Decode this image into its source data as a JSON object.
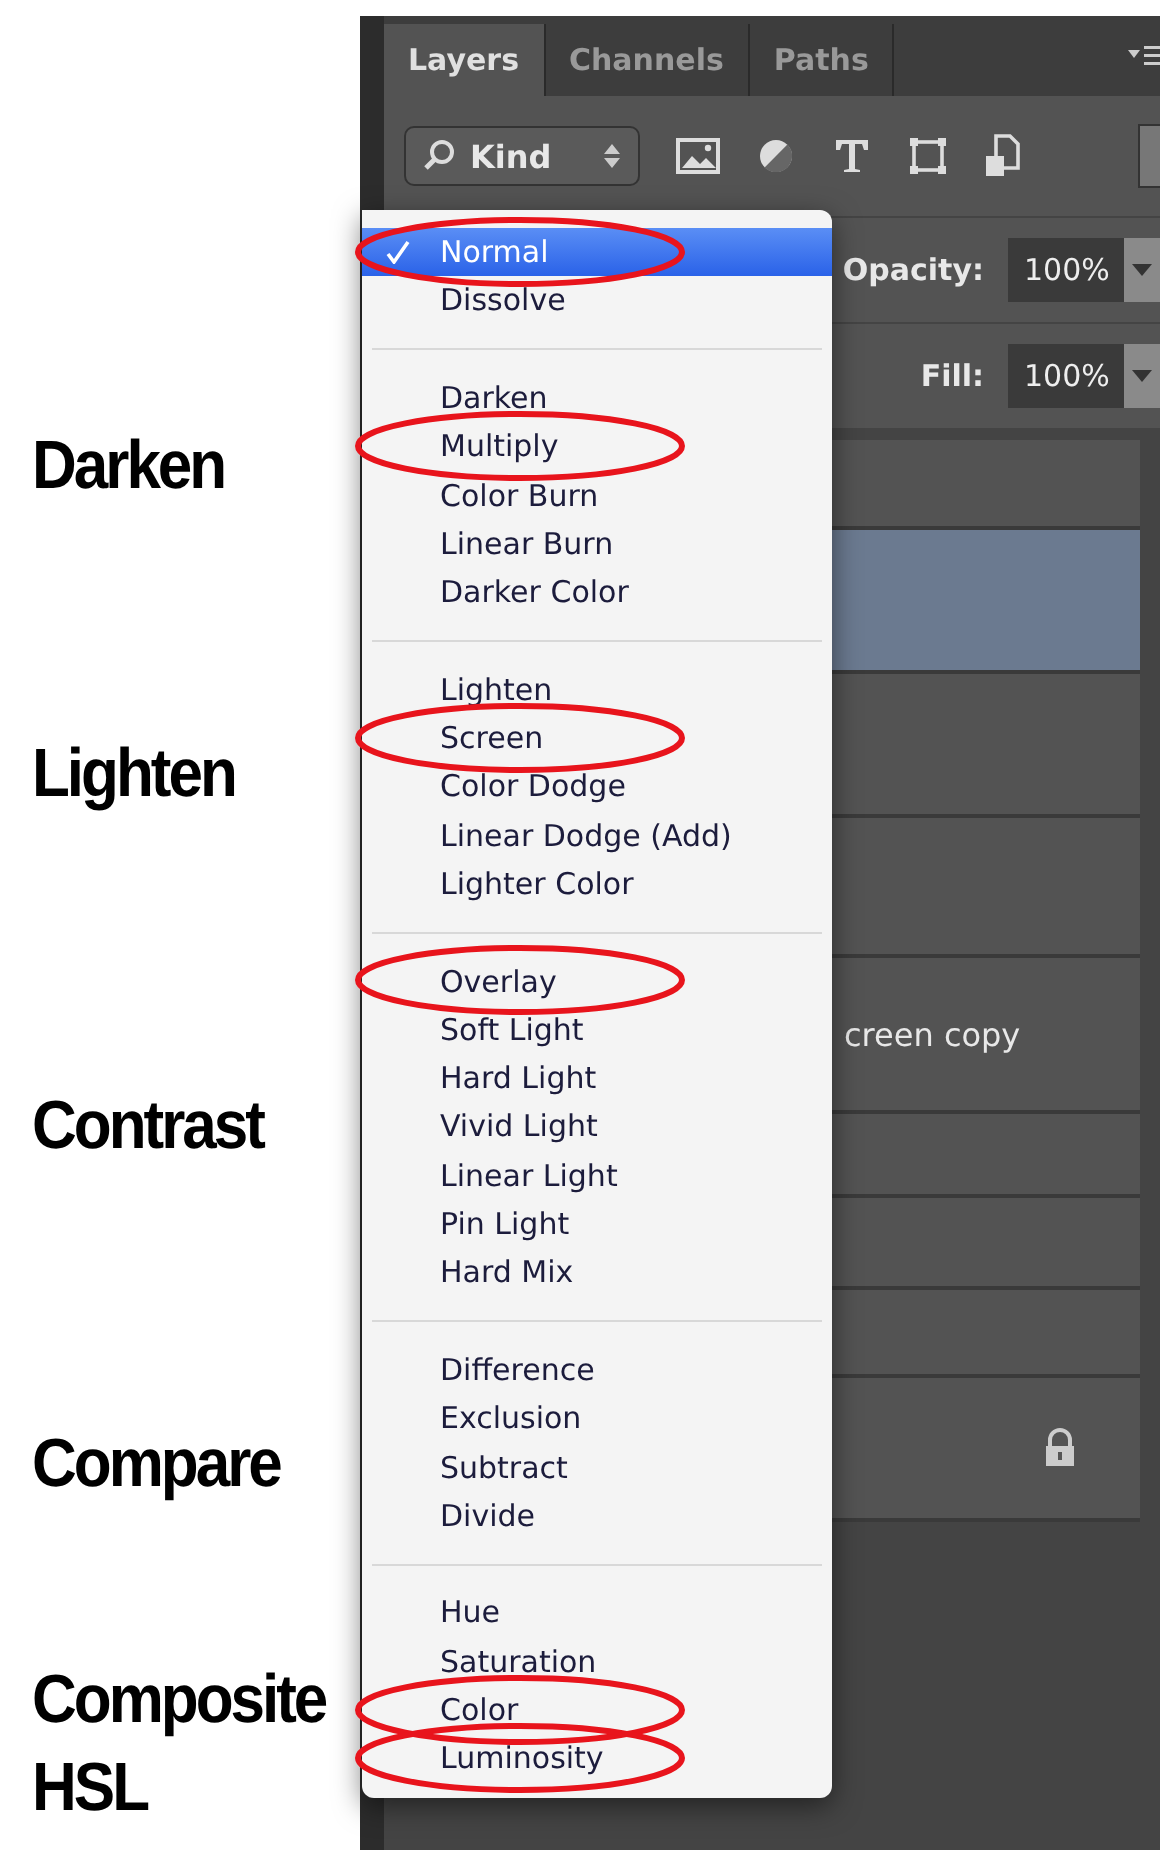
{
  "annotations": [
    {
      "label": "Darken"
    },
    {
      "label": "Lighten"
    },
    {
      "label": "Contrast"
    },
    {
      "label": "Compare"
    },
    {
      "label": "Composite HSL"
    }
  ],
  "tabs": [
    {
      "label": "Layers",
      "selected": true
    },
    {
      "label": "Channels",
      "selected": false
    },
    {
      "label": "Paths",
      "selected": false
    }
  ],
  "filter": {
    "label": "Kind"
  },
  "opacity": {
    "label": "Opacity:",
    "value": "100%"
  },
  "fill": {
    "label": "Fill:",
    "value": "100%"
  },
  "layers": [
    {
      "selected": false
    },
    {
      "selected": true
    },
    {
      "selected": false
    },
    {
      "selected": false
    },
    {
      "selected": false,
      "name": "creen copy"
    },
    {
      "selected": false
    },
    {
      "selected": false
    },
    {
      "selected": false
    },
    {
      "selected": false,
      "locked": true
    }
  ],
  "blend_menu": [
    {
      "kind": "item",
      "label": "Normal",
      "selected": true,
      "circled": true
    },
    {
      "kind": "item",
      "label": "Dissolve",
      "selected": false,
      "circled": false
    },
    {
      "kind": "separator"
    },
    {
      "kind": "item",
      "label": "Darken",
      "selected": false,
      "circled": false
    },
    {
      "kind": "item",
      "label": "Multiply",
      "selected": false,
      "circled": true
    },
    {
      "kind": "item",
      "label": "Color Burn",
      "selected": false,
      "circled": false
    },
    {
      "kind": "item",
      "label": "Linear Burn",
      "selected": false,
      "circled": false
    },
    {
      "kind": "item",
      "label": "Darker Color",
      "selected": false,
      "circled": false
    },
    {
      "kind": "separator"
    },
    {
      "kind": "item",
      "label": "Lighten",
      "selected": false,
      "circled": false
    },
    {
      "kind": "item",
      "label": "Screen",
      "selected": false,
      "circled": true
    },
    {
      "kind": "item",
      "label": "Color Dodge",
      "selected": false,
      "circled": false
    },
    {
      "kind": "item",
      "label": "Linear Dodge (Add)",
      "selected": false,
      "circled": false
    },
    {
      "kind": "item",
      "label": "Lighter Color",
      "selected": false,
      "circled": false
    },
    {
      "kind": "separator"
    },
    {
      "kind": "item",
      "label": "Overlay",
      "selected": false,
      "circled": true
    },
    {
      "kind": "item",
      "label": "Soft Light",
      "selected": false,
      "circled": false
    },
    {
      "kind": "item",
      "label": "Hard Light",
      "selected": false,
      "circled": false
    },
    {
      "kind": "item",
      "label": "Vivid Light",
      "selected": false,
      "circled": false
    },
    {
      "kind": "item",
      "label": "Linear Light",
      "selected": false,
      "circled": false
    },
    {
      "kind": "item",
      "label": "Pin Light",
      "selected": false,
      "circled": false
    },
    {
      "kind": "item",
      "label": "Hard Mix",
      "selected": false,
      "circled": false
    },
    {
      "kind": "separator"
    },
    {
      "kind": "item",
      "label": "Difference",
      "selected": false,
      "circled": false
    },
    {
      "kind": "item",
      "label": "Exclusion",
      "selected": false,
      "circled": false
    },
    {
      "kind": "item",
      "label": "Subtract",
      "selected": false,
      "circled": false
    },
    {
      "kind": "item",
      "label": "Divide",
      "selected": false,
      "circled": false
    },
    {
      "kind": "separator"
    },
    {
      "kind": "item",
      "label": "Hue",
      "selected": false,
      "circled": false
    },
    {
      "kind": "item",
      "label": "Saturation",
      "selected": false,
      "circled": false
    },
    {
      "kind": "item",
      "label": "Color",
      "selected": false,
      "circled": true
    },
    {
      "kind": "item",
      "label": "Luminosity",
      "selected": false,
      "circled": true
    }
  ]
}
